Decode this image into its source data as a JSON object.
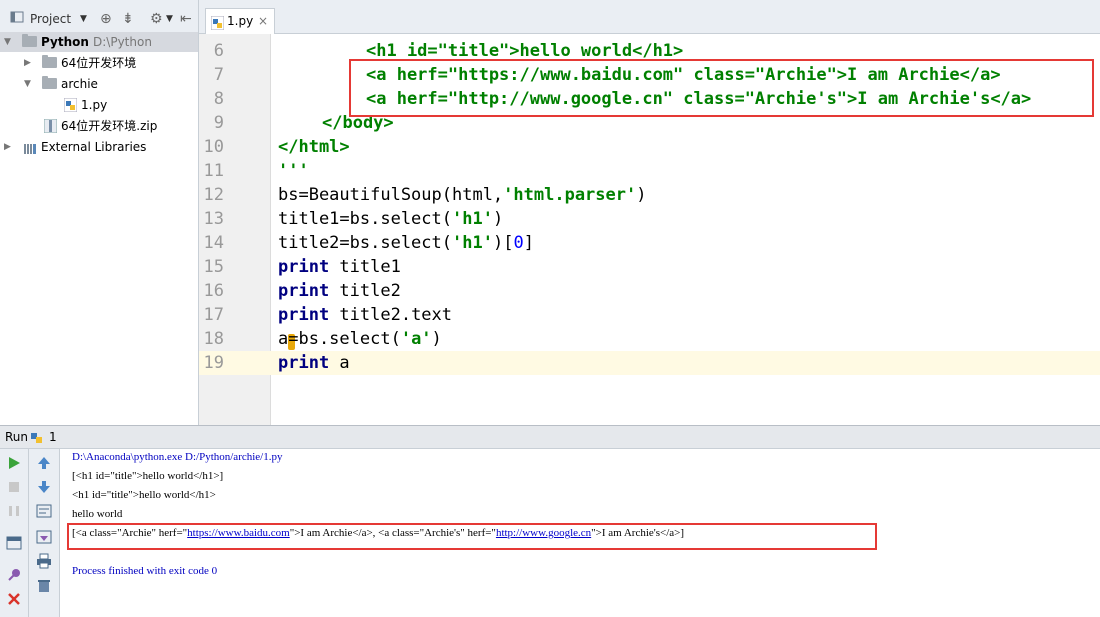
{
  "project_toolbar": {
    "title": "Project"
  },
  "tree": [
    {
      "label": "Python",
      "path": "D:\\Python"
    },
    {
      "label": "64位开发环境"
    },
    {
      "label": "archie"
    },
    {
      "label": "1.py"
    },
    {
      "label": "64位开发环境.zip"
    },
    {
      "label": "External Libraries"
    }
  ],
  "editor_tab": {
    "label": "1.py",
    "close": "×"
  },
  "code_lines": [
    {
      "n": "6",
      "text": "<h1 id=\"title\">hello world</h1>"
    },
    {
      "n": "7",
      "text": "<a herf=\"https://www.baidu.com\" class=\"Archie\">I am Archie</a>"
    },
    {
      "n": "8",
      "text": "<a herf=\"http://www.google.cn\" class=\"Archie's\">I am Archie's</a>"
    },
    {
      "n": "9",
      "text": "</body>"
    },
    {
      "n": "10",
      "text": "</html>"
    },
    {
      "n": "11",
      "text": "'''"
    },
    {
      "n": "12",
      "kw": "",
      "text": "bs=BeautifulSoup(html,",
      "str": "'html.parser'",
      "tail": ")"
    },
    {
      "n": "13",
      "text": "title1=bs.select(",
      "str": "'h1'",
      "tail": ")"
    },
    {
      "n": "14",
      "text": "title2=bs.select(",
      "str": "'h1'",
      "tail": ")[",
      "num": "0",
      "tail2": "]"
    },
    {
      "n": "15",
      "kw": "print",
      "text": " title1"
    },
    {
      "n": "16",
      "kw": "print",
      "text": " title2"
    },
    {
      "n": "17",
      "kw": "print",
      "text": " title2.text"
    },
    {
      "n": "18",
      "text": "a=bs.select(",
      "str": "'a'",
      "tail": ")"
    },
    {
      "n": "19",
      "kw": "print",
      "text": " a"
    }
  ],
  "run_panel": {
    "label": "Run",
    "config": "1"
  },
  "console": {
    "line1": "D:\\Anaconda\\python.exe D:/Python/archie/1.py",
    "line2": "[<h1 id=\"title\">hello world</h1>]",
    "line3": "<h1 id=\"title\">hello world</h1>",
    "line4": "hello world",
    "line5_a": "[<a class=\"Archie\" herf=\"",
    "line5_link1": "https://www.baidu.com",
    "line5_b": "\">I am Archie</a>, <a class=\"Archie's\" herf=\"",
    "line5_link2": "http://www.google.cn",
    "line5_c": "\">I am Archie's</a>]",
    "line6": "Process finished with exit code 0"
  },
  "colors": {
    "highlight_box": "#e53935",
    "tag_green": "#008000",
    "keyword_navy": "#000080"
  }
}
